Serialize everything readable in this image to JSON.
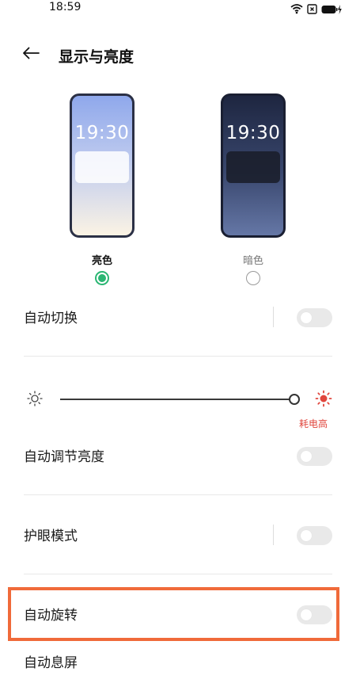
{
  "status_bar": {
    "time": "18:59"
  },
  "header": {
    "title": "显示与亮度"
  },
  "themes": [
    {
      "label": "亮色",
      "clock": "19:30",
      "selected": true
    },
    {
      "label": "暗色",
      "clock": "19:30",
      "selected": false
    }
  ],
  "settings": {
    "auto_switch": {
      "label": "自动切换",
      "enabled": false
    },
    "brightness": {
      "level": 1.0,
      "note": "耗电高"
    },
    "auto_brightness": {
      "label": "自动调节亮度",
      "enabled": false
    },
    "eye_care": {
      "label": "护眼模式",
      "enabled": false
    },
    "auto_rotate": {
      "label": "自动旋转",
      "enabled": false
    },
    "auto_screen_off": {
      "label": "自动息屏"
    }
  },
  "colors": {
    "accent_green": "#2bb673",
    "highlight_orange": "#f06a3a",
    "warning_red": "#e0463d"
  },
  "icons": {
    "back": "arrow-left-icon",
    "wifi": "wifi-icon",
    "sim": "sim-icon",
    "battery": "battery-charging-icon",
    "sun_low": "sun-dim-icon",
    "sun_high": "sun-bright-icon"
  }
}
